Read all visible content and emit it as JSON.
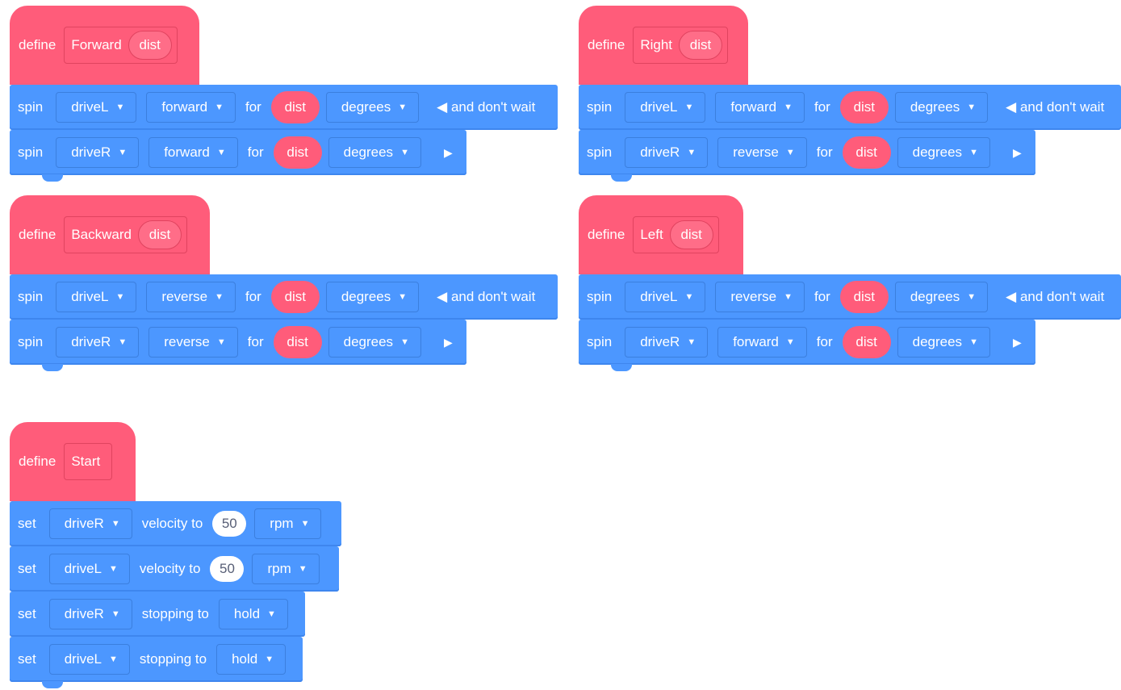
{
  "define_label": "define",
  "scripts": [
    {
      "name": "Forward",
      "arg": "dist",
      "blocks": [
        {
          "op": "spin",
          "motor": "driveL",
          "dir": "forward",
          "for": "for",
          "value": "dist",
          "unit": "degrees",
          "tail": "◀ and don't wait"
        },
        {
          "op": "spin",
          "motor": "driveR",
          "dir": "forward",
          "for": "for",
          "value": "dist",
          "unit": "degrees",
          "tail": "▶"
        }
      ]
    },
    {
      "name": "Right",
      "arg": "dist",
      "blocks": [
        {
          "op": "spin",
          "motor": "driveL",
          "dir": "forward",
          "for": "for",
          "value": "dist",
          "unit": "degrees",
          "tail": "◀ and don't wait"
        },
        {
          "op": "spin",
          "motor": "driveR",
          "dir": "reverse",
          "for": "for",
          "value": "dist",
          "unit": "degrees",
          "tail": "▶"
        }
      ]
    },
    {
      "name": "Backward",
      "arg": "dist",
      "blocks": [
        {
          "op": "spin",
          "motor": "driveL",
          "dir": "reverse",
          "for": "for",
          "value": "dist",
          "unit": "degrees",
          "tail": "◀ and don't wait"
        },
        {
          "op": "spin",
          "motor": "driveR",
          "dir": "reverse",
          "for": "for",
          "value": "dist",
          "unit": "degrees",
          "tail": "▶"
        }
      ]
    },
    {
      "name": "Left",
      "arg": "dist",
      "blocks": [
        {
          "op": "spin",
          "motor": "driveL",
          "dir": "reverse",
          "for": "for",
          "value": "dist",
          "unit": "degrees",
          "tail": "◀ and don't wait"
        },
        {
          "op": "spin",
          "motor": "driveR",
          "dir": "forward",
          "for": "for",
          "value": "dist",
          "unit": "degrees",
          "tail": "▶"
        }
      ]
    },
    {
      "name": "Start",
      "blocks": [
        {
          "op": "set",
          "motor": "driveR",
          "label": "velocity to",
          "num": "50",
          "unit": "rpm"
        },
        {
          "op": "set",
          "motor": "driveL",
          "label": "velocity to",
          "num": "50",
          "unit": "rpm"
        },
        {
          "op": "set",
          "motor": "driveR",
          "label": "stopping to",
          "mode": "hold"
        },
        {
          "op": "set",
          "motor": "driveL",
          "label": "stopping to",
          "mode": "hold"
        }
      ]
    }
  ]
}
